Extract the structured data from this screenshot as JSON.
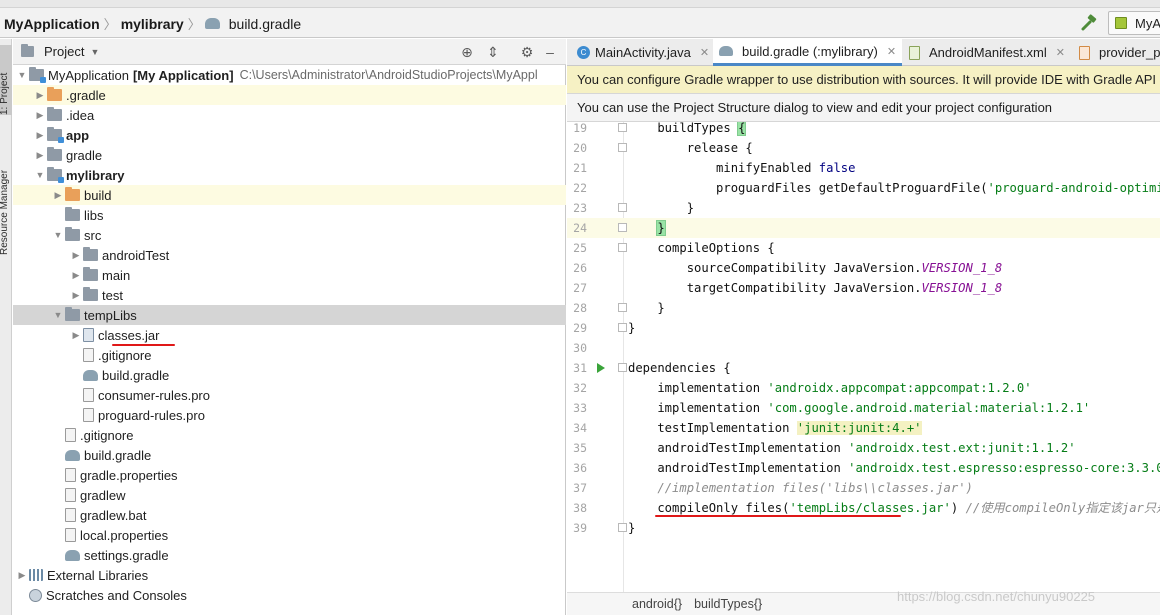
{
  "breadcrumb": {
    "items": [
      "MyApplication",
      "mylibrary"
    ],
    "file": "build.gradle",
    "run_config": "MyA"
  },
  "side_tabs": {
    "project": "1: Project",
    "resource_manager": "Resource Manager"
  },
  "project_panel": {
    "title": "Project",
    "tree": [
      {
        "label": "MyApplication",
        "extra_bold": "[My Application]",
        "path": "C:\\Users\\Administrator\\AndroidStudioProjects\\MyAppl",
        "icon": "module-icon",
        "expanded": true
      },
      {
        "label": ".gradle",
        "icon": "folder-orange-icon"
      },
      {
        "label": ".idea",
        "icon": "folder-icon"
      },
      {
        "label": "app",
        "icon": "module-folder-icon",
        "bold": true
      },
      {
        "label": "gradle",
        "icon": "folder-icon"
      },
      {
        "label": "mylibrary",
        "icon": "module-folder-icon",
        "bold": true,
        "expanded": true
      },
      {
        "label": "build",
        "icon": "folder-orange-icon"
      },
      {
        "label": "libs",
        "icon": "folder-icon"
      },
      {
        "label": "src",
        "icon": "folder-icon",
        "expanded": true
      },
      {
        "label": "androidTest",
        "icon": "folder-icon"
      },
      {
        "label": "main",
        "icon": "folder-icon"
      },
      {
        "label": "test",
        "icon": "folder-icon"
      },
      {
        "label": "tempLibs",
        "icon": "folder-icon",
        "expanded": true
      },
      {
        "label": "classes.jar",
        "icon": "jar-icon"
      },
      {
        "label": ".gitignore",
        "icon": "file-icon"
      },
      {
        "label": "build.gradle",
        "icon": "gradle-icon"
      },
      {
        "label": "consumer-rules.pro",
        "icon": "file-icon"
      },
      {
        "label": "proguard-rules.pro",
        "icon": "file-icon"
      },
      {
        "label": ".gitignore",
        "icon": "file-icon"
      },
      {
        "label": "build.gradle",
        "icon": "gradle-icon"
      },
      {
        "label": "gradle.properties",
        "icon": "file-icon"
      },
      {
        "label": "gradlew",
        "icon": "file-icon"
      },
      {
        "label": "gradlew.bat",
        "icon": "file-icon"
      },
      {
        "label": "local.properties",
        "icon": "file-icon"
      },
      {
        "label": "settings.gradle",
        "icon": "gradle-icon"
      },
      {
        "label": "External Libraries",
        "icon": "libraries-icon"
      },
      {
        "label": "Scratches and Consoles",
        "icon": "scratches-icon"
      }
    ]
  },
  "editor": {
    "tabs": [
      {
        "label": "MainActivity.java",
        "icon": "java-class-icon"
      },
      {
        "label": "build.gradle (:mylibrary)",
        "icon": "gradle-icon",
        "active": true
      },
      {
        "label": "AndroidManifest.xml",
        "icon": "manifest-icon"
      },
      {
        "label": "provider_p",
        "icon": "xml-icon"
      }
    ],
    "notice_wrapper": "You can configure Gradle wrapper to use distribution with sources. It will provide IDE with Gradle API",
    "notice_structure": "You can use the Project Structure dialog to view and edit your project configuration",
    "lines": [
      {
        "no": "19",
        "code": "    buildTypes {"
      },
      {
        "no": "20",
        "code": "        release {"
      },
      {
        "no": "21",
        "code": "            minifyEnabled false"
      },
      {
        "no": "22",
        "code": "            proguardFiles getDefaultProguardFile('proguard-android-optimize.txt'), 'proguard-rules.pro'"
      },
      {
        "no": "23",
        "code": "        }"
      },
      {
        "no": "24",
        "code": "    }"
      },
      {
        "no": "25",
        "code": "    compileOptions {"
      },
      {
        "no": "26",
        "code": "        sourceCompatibility JavaVersion.VERSION_1_8"
      },
      {
        "no": "27",
        "code": "        targetCompatibility JavaVersion.VERSION_1_8"
      },
      {
        "no": "28",
        "code": "    }"
      },
      {
        "no": "29",
        "code": "}"
      },
      {
        "no": "30",
        "code": ""
      },
      {
        "no": "31",
        "code": "dependencies {"
      },
      {
        "no": "32",
        "code": "    implementation 'androidx.appcompat:appcompat:1.2.0'"
      },
      {
        "no": "33",
        "code": "    implementation 'com.google.android.material:material:1.2.1'"
      },
      {
        "no": "34",
        "code": "    testImplementation 'junit:junit:4.+'"
      },
      {
        "no": "35",
        "code": "    androidTestImplementation 'androidx.test.ext:junit:1.1.2'"
      },
      {
        "no": "36",
        "code": "    androidTestImplementation 'androidx.test.espresso:espresso-core:3.3.0'"
      },
      {
        "no": "37",
        "code": "    //implementation files('libs\\\\classes.jar')"
      },
      {
        "no": "38",
        "code": "    compileOnly files('tempLibs/classes.jar') //使用compileOnly指定该jar只是为"
      },
      {
        "no": "39",
        "code": "}"
      }
    ],
    "code_breadcrumb": [
      "android{}",
      "buildTypes{}"
    ]
  },
  "watermark": "https://blog.csdn.net/chunyu90225"
}
